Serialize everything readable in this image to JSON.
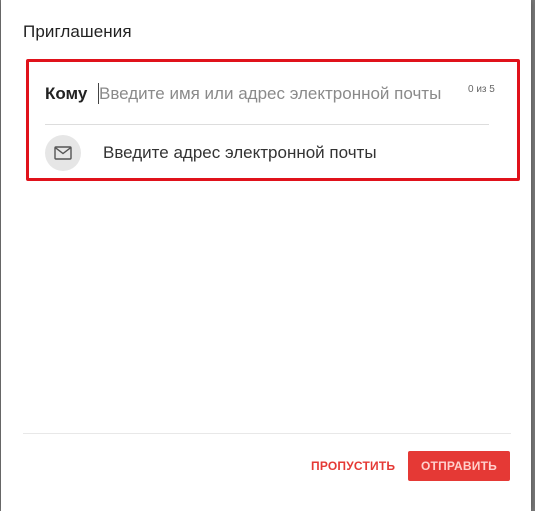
{
  "dialog": {
    "title": "Приглашения"
  },
  "recipients": {
    "label": "Кому",
    "placeholder": "Введите имя или адрес электронной почты",
    "counter": "0 из 5"
  },
  "suggestion": {
    "icon": "mail-icon",
    "text": "Введите адрес электронной почты"
  },
  "footer": {
    "skip_label": "ПРОПУСТИТЬ",
    "send_label": "ОТПРАВИТЬ"
  },
  "colors": {
    "accent": "#e53935",
    "highlight": "#e0121b"
  }
}
